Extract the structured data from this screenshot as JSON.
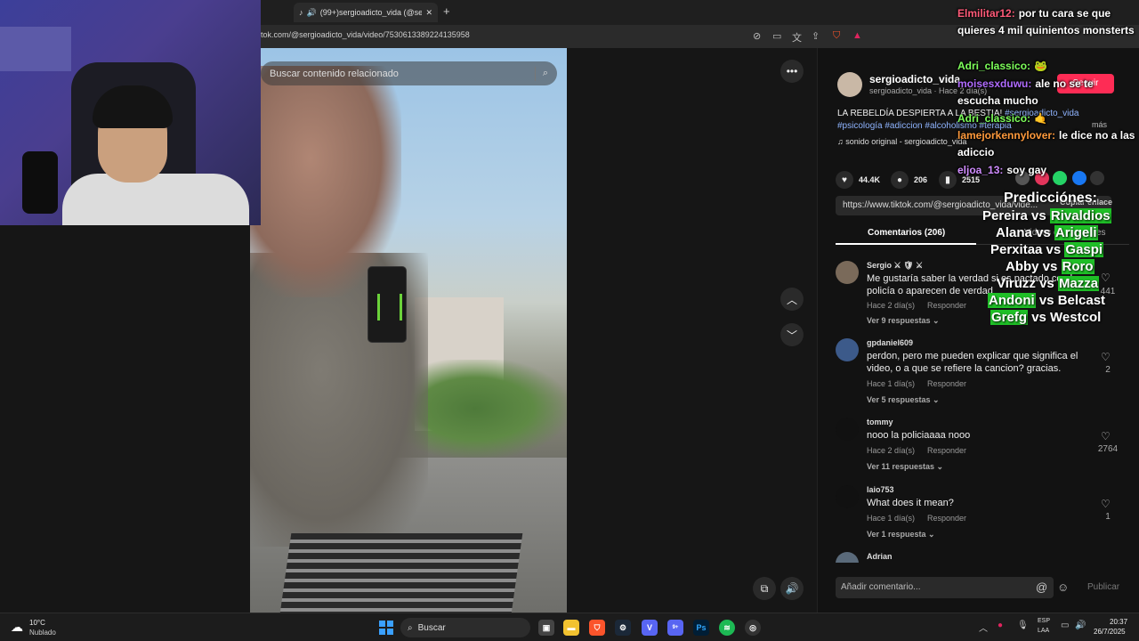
{
  "browser": {
    "tab_title": "(99+)sergioadicto_vida (@ser",
    "url": "tok.com/@sergioadicto_vida/video/7530613389224135958"
  },
  "video": {
    "search_placeholder": "Buscar contenido relacionado"
  },
  "post": {
    "author": "sergioadicto_vida",
    "author_sub": "sergioadicto_vida · Hace 2 día(s)",
    "follow_label": "Seguir",
    "caption": "LA REBELDÍA DESPIERTA A LA BESTIA!",
    "caption_tags_1": "#sergioadicto_vida",
    "caption_tags_2": "#psicología #adiccion #alcoholismo #terapia",
    "more_label": "más",
    "music": "♫  sonido original - sergioadicto_vida",
    "likes": "44.4K",
    "comments_count": "206",
    "saves": "2515",
    "link": "https://www.tiktok.com/@sergioadicto_vida/vide...",
    "copy_link_label": "Copiar enlace",
    "tab_comments": "Comentarios (206)",
    "tab_related": "Videos de creadores"
  },
  "comments": [
    {
      "user": "Sergio ⚔ 🛡 ⚔",
      "text": "Me gustaría saber la verdad si es pactado con la policía o aparecen de verdad",
      "meta": "Hace 2 día(s)",
      "reply": "Responder",
      "more": "Ver 9 respuestas ⌄",
      "likes": "441"
    },
    {
      "user": "gpdaniel609",
      "text": "perdon, pero me pueden explicar que significa el video, o a que se refiere la cancion? gracias.",
      "meta": "Hace 1 día(s)",
      "reply": "Responder",
      "more": "Ver 5 respuestas ⌄",
      "likes": "2"
    },
    {
      "user": "tommy",
      "text": "nooo la policiaaaa nooo",
      "meta": "Hace 2 día(s)",
      "reply": "Responder",
      "more": "Ver 11 respuestas ⌄",
      "likes": "2764"
    },
    {
      "user": "laio753",
      "text": "What does it mean?",
      "meta": "Hace 1 día(s)",
      "reply": "Responder",
      "more": "Ver 1 respuesta ⌄",
      "likes": "1"
    },
    {
      "user": "Adrian",
      "text": "",
      "meta": "",
      "reply": "",
      "more": "",
      "likes": ""
    }
  ],
  "comment_box": {
    "placeholder": "Añadir comentario...",
    "publish": "Publicar"
  },
  "chat": [
    {
      "user": "Elmilitar12:",
      "user_color": "#ff5a78",
      "text": "por tu cara se que quieres 4 mil quinientos monsterts"
    },
    {
      "user": "Adri_classico:",
      "user_color": "#7dff5a",
      "text": "🐸"
    },
    {
      "user": "moisesxduwu:",
      "user_color": "#b06bff",
      "text": "ale no se te escucha mucho"
    },
    {
      "user": "Adri_classico:",
      "user_color": "#7dff5a",
      "text": "🤙"
    },
    {
      "user": "lamejorkennylover:",
      "user_color": "#ff9a3c",
      "text": "le dice no a las adiccio"
    },
    {
      "user": "eljoa_13:",
      "user_color": "#d08cff",
      "text": "soy gay"
    }
  ],
  "predictions": {
    "title": "Predicciónes:",
    "matches": [
      {
        "a": "Pereira",
        "b": "Rivaldios",
        "winner": "b"
      },
      {
        "a": "Alana",
        "b": "Arigeli",
        "winner": "b"
      },
      {
        "a": "Perxitaa",
        "b": "Gaspi",
        "winner": "b"
      },
      {
        "a": "Abby",
        "b": "Roro",
        "winner": "b"
      },
      {
        "a": "Viruzz",
        "b": "Mazza",
        "winner": "b"
      },
      {
        "a": "Andoni",
        "b": "Belcast",
        "winner": "a"
      },
      {
        "a": "Grefg",
        "b": "Westcol",
        "winner": "a"
      }
    ],
    "vs": "vs"
  },
  "taskbar": {
    "temp": "10°C",
    "weather": "Nublado",
    "search_label": "Buscar",
    "lang1": "ESP",
    "lang2": "LAA",
    "time": "20:37",
    "date": "26/7/2025",
    "discord_badge": "9+"
  },
  "colors": {
    "tiktok_red": "#fe2c55",
    "prediction_highlight": "#1fbf27"
  }
}
